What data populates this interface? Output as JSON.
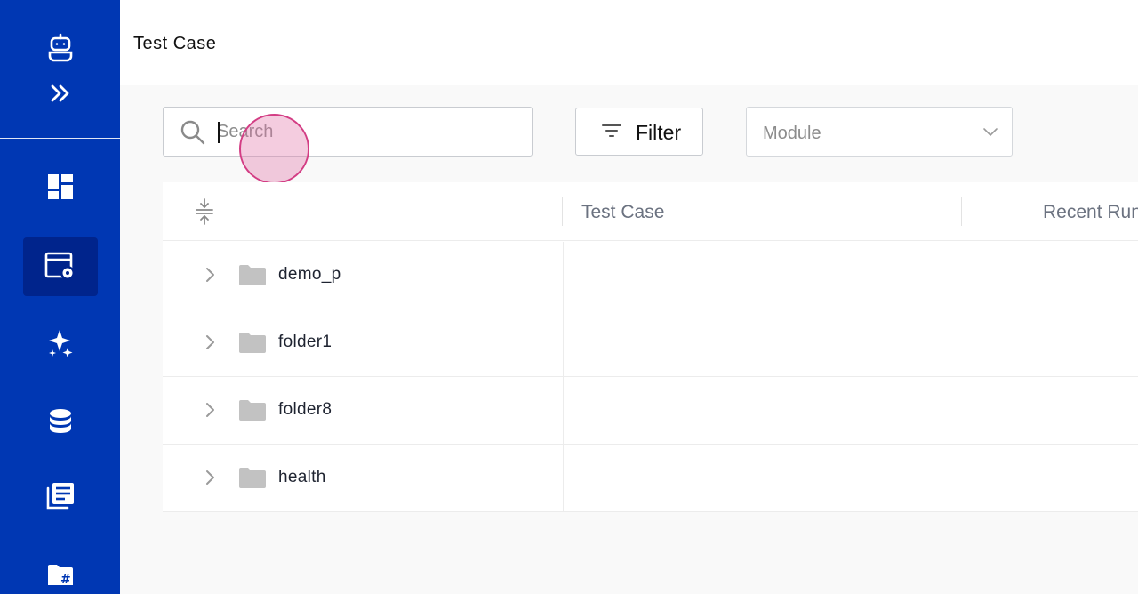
{
  "header": {
    "title": "Test Case"
  },
  "sidebar": {
    "items": [
      {
        "name": "bot-icon"
      },
      {
        "name": "expand-icon"
      },
      {
        "name": "dashboard-icon"
      },
      {
        "name": "test-case-icon",
        "active": true
      },
      {
        "name": "sparkle-icon"
      },
      {
        "name": "database-icon"
      },
      {
        "name": "reports-icon"
      },
      {
        "name": "hash-folder-icon"
      }
    ],
    "background": "#0037b3",
    "active_background": "#00248c"
  },
  "toolbar": {
    "search_placeholder": "Search",
    "search_value": "",
    "filter_label": "Filter",
    "module_placeholder": "Module"
  },
  "table": {
    "columns": [
      "Test Case",
      "Recent Run"
    ],
    "rows": [
      {
        "name": "demo_p",
        "type": "folder"
      },
      {
        "name": "folder1",
        "type": "folder"
      },
      {
        "name": "folder8",
        "type": "folder"
      },
      {
        "name": "health",
        "type": "folder"
      }
    ]
  }
}
